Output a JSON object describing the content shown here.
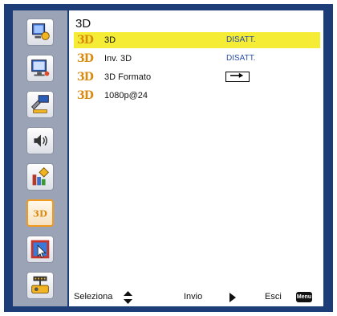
{
  "menu": {
    "title": "3D",
    "rows": [
      {
        "icon": "3D",
        "label": "3D",
        "value": "DISATT.",
        "selected": true
      },
      {
        "icon": "3D",
        "label": "Inv. 3D",
        "value": "DISATT.",
        "selected": false
      },
      {
        "icon": "3D",
        "label": "3D Formato",
        "value_icon": "side-by-side-format-icon",
        "selected": false
      },
      {
        "icon": "3D",
        "label": "1080p@24",
        "selected": false
      }
    ]
  },
  "sidebar": {
    "items": [
      {
        "icon": "image-settings-icon"
      },
      {
        "icon": "display-settings-icon"
      },
      {
        "icon": "setup-icon"
      },
      {
        "icon": "audio-icon"
      },
      {
        "icon": "options-icon"
      },
      {
        "icon": "3d-icon",
        "text": "3D",
        "active": true
      },
      {
        "icon": "interactive-icon"
      },
      {
        "icon": "lan-icon"
      }
    ]
  },
  "footer": {
    "select_label": "Seleziona",
    "enter_label": "Invio",
    "exit_label": "Esci",
    "menu_key_label": "Menu"
  },
  "colors": {
    "frame": "#1d3d78",
    "sidebar": "#9aa4b6",
    "highlight": "#f4ec35",
    "value_text": "#2b4fa8",
    "accent": "#f19a1c"
  }
}
